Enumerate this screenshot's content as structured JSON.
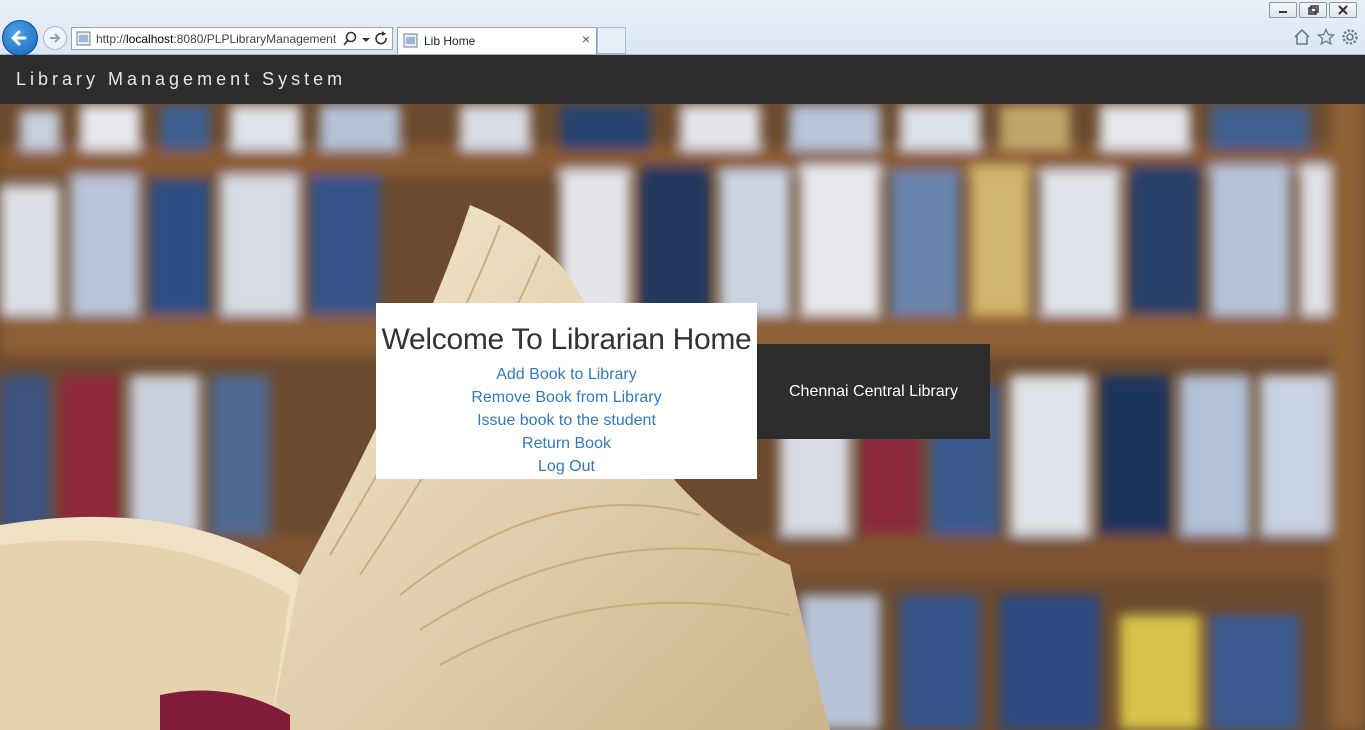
{
  "browser": {
    "url_prefix": "http://",
    "url_host": "localhost",
    "url_rest": ":8080/PLPLibraryManagement",
    "tab_title": "Lib Home",
    "tab_close": "×"
  },
  "navbar": {
    "brand": "Library Management System"
  },
  "welcome": {
    "title": "Welcome To Librarian Home",
    "links": [
      "Add Book to Library",
      "Remove Book from Library",
      "Issue book to the student",
      "Return Book",
      "Log Out"
    ]
  },
  "library": {
    "name": "Chennai Central Library"
  },
  "colors": {
    "navbar_bg": "#2d2d2d",
    "link": "#337ab7",
    "back_button": "#1466b8"
  },
  "icons": [
    "back-arrow-icon",
    "forward-arrow-icon",
    "page-icon",
    "search-icon",
    "dropdown-icon",
    "refresh-icon",
    "home-icon",
    "favorites-star-icon",
    "settings-gear-icon"
  ]
}
